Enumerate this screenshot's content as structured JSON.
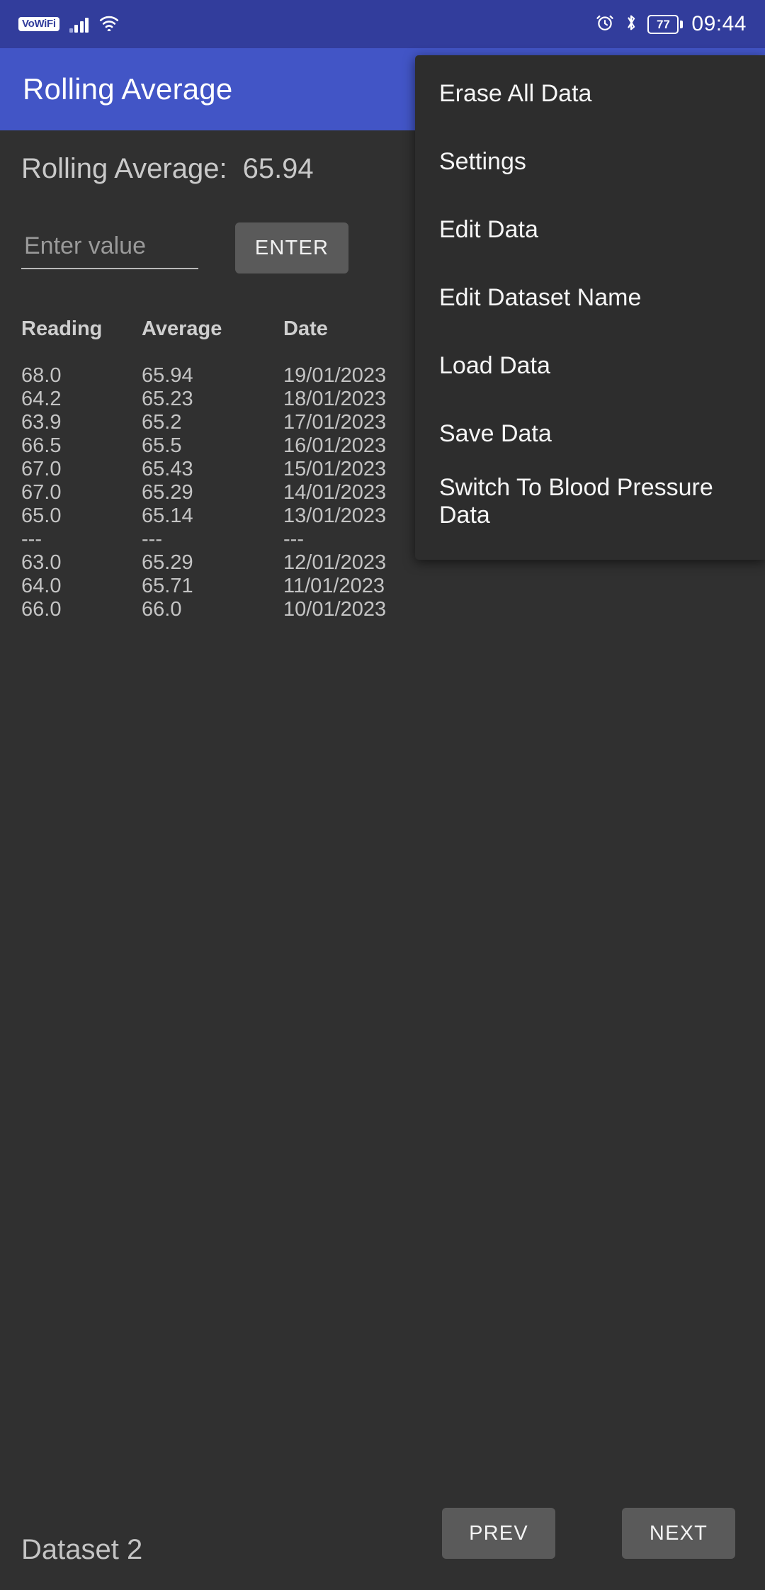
{
  "status_bar": {
    "vowifi_label": "VoWiFi",
    "battery_level": "77",
    "time": "09:44",
    "icons": [
      "vowifi-icon",
      "cellular-signal-icon",
      "wifi-icon",
      "alarm-icon",
      "bluetooth-icon",
      "battery-icon"
    ]
  },
  "app_bar": {
    "title": "Rolling Average"
  },
  "summary": {
    "label": "Rolling Average:",
    "value": "65.94"
  },
  "input": {
    "placeholder": "Enter value",
    "value": "",
    "enter_label": "ENTER"
  },
  "table": {
    "columns": [
      "Reading",
      "Average",
      "Date"
    ],
    "rows": [
      {
        "reading": "68.0",
        "average": "65.94",
        "date": "19/01/2023"
      },
      {
        "reading": "64.2",
        "average": "65.23",
        "date": "18/01/2023"
      },
      {
        "reading": "63.9",
        "average": "65.2",
        "date": "17/01/2023"
      },
      {
        "reading": "66.5",
        "average": "65.5",
        "date": "16/01/2023"
      },
      {
        "reading": "67.0",
        "average": "65.43",
        "date": "15/01/2023"
      },
      {
        "reading": "67.0",
        "average": "65.29",
        "date": "14/01/2023"
      },
      {
        "reading": "65.0",
        "average": "65.14",
        "date": "13/01/2023"
      },
      {
        "reading": "---",
        "average": "---",
        "date": "---"
      },
      {
        "reading": "63.0",
        "average": "65.29",
        "date": "12/01/2023"
      },
      {
        "reading": "64.0",
        "average": "65.71",
        "date": "11/01/2023"
      },
      {
        "reading": "66.0",
        "average": "66.0",
        "date": "10/01/2023"
      }
    ]
  },
  "bottom_bar": {
    "dataset_label": "Dataset 2",
    "prev_label": "PREV",
    "next_label": "NEXT"
  },
  "overflow_menu": {
    "visible": true,
    "items": [
      "Erase All Data",
      "Settings",
      "Edit Data",
      "Edit Dataset Name",
      "Load Data",
      "Save Data",
      "Switch To Blood Pressure Data"
    ]
  },
  "colors": {
    "status_bar_bg": "#323d9c",
    "app_bar_bg": "#4255c6",
    "page_bg": "#303030",
    "menu_bg": "#2d2d2d",
    "button_bg": "#5a5a5a",
    "text_primary": "#c4c4c4"
  }
}
